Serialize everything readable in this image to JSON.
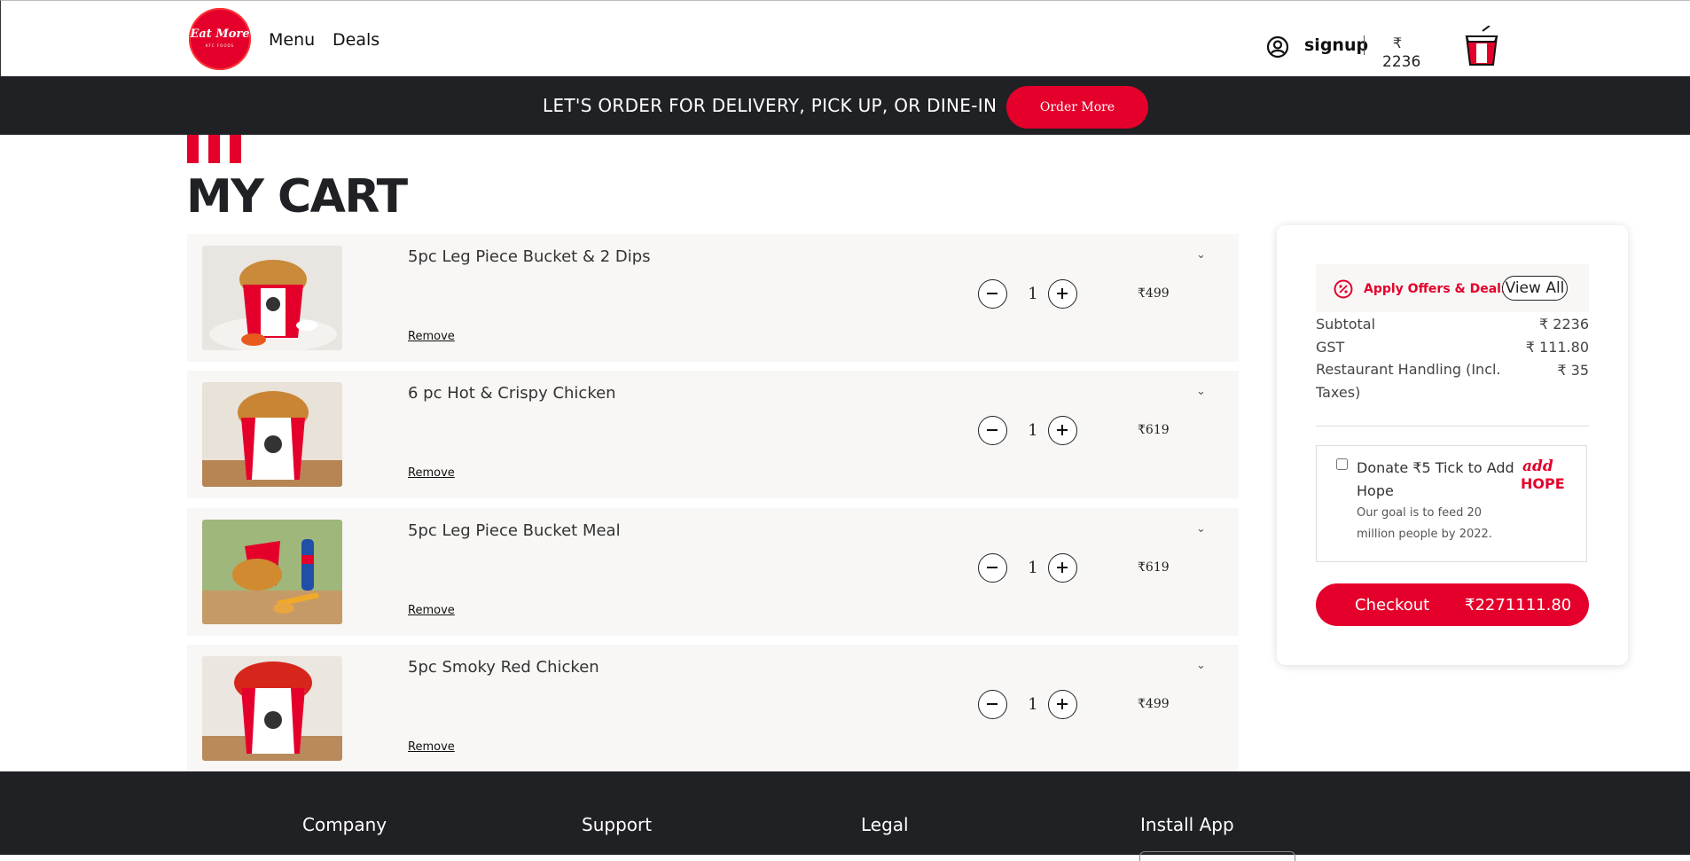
{
  "header": {
    "logo_text": "Eat More",
    "logo_sub": "KFC FOODS",
    "nav": [
      "Menu",
      "Deals"
    ],
    "signup_label": "signup",
    "cart_currency": "₹",
    "cart_total": "2236",
    "user_icon": "user-circle-icon",
    "bucket_icon": "bucket-icon"
  },
  "banner": {
    "text": "LET'S ORDER FOR DELIVERY, PICK UP, OR DINE-IN",
    "button_label": "Order More"
  },
  "page": {
    "title": "MY CART"
  },
  "cart": {
    "items": [
      {
        "name": "5pc Leg Piece Bucket & 2 Dips",
        "qty": "1",
        "price": "₹499",
        "remove_label": "Remove",
        "chevron": "⌄"
      },
      {
        "name": "6 pc Hot & Crispy Chicken",
        "qty": "1",
        "price": "₹619",
        "remove_label": "Remove",
        "chevron": "⌄"
      },
      {
        "name": "5pc Leg Piece Bucket Meal",
        "qty": "1",
        "price": "₹619",
        "remove_label": "Remove",
        "chevron": "⌄"
      },
      {
        "name": "5pc Smoky Red Chicken",
        "qty": "1",
        "price": "₹499",
        "remove_label": "Remove",
        "chevron": "⌄"
      }
    ]
  },
  "summary": {
    "offers_label": "Apply Offers & Deals",
    "view_all_label": "View All",
    "subtotal_label": "Subtotal",
    "subtotal_value": "₹ 2236",
    "gst_label": "GST",
    "gst_value": "₹ 111.80",
    "handling_label": "Restaurant Handling (Incl. Taxes)",
    "handling_value": "₹ 35",
    "donate_title": "Donate ₹5 Tick to Add Hope",
    "donate_sub": "Our goal is to feed 20 million people by 2022.",
    "addhope_text": "add HOPE",
    "checkout_label": "Checkout",
    "checkout_amount": "₹2271111.80"
  },
  "footer": {
    "columns": [
      "Company",
      "Support",
      "Legal",
      "Install App"
    ]
  },
  "colors": {
    "brand_red": "#e4002b",
    "dark": "#202124",
    "item_bg": "#f8f7f5"
  }
}
